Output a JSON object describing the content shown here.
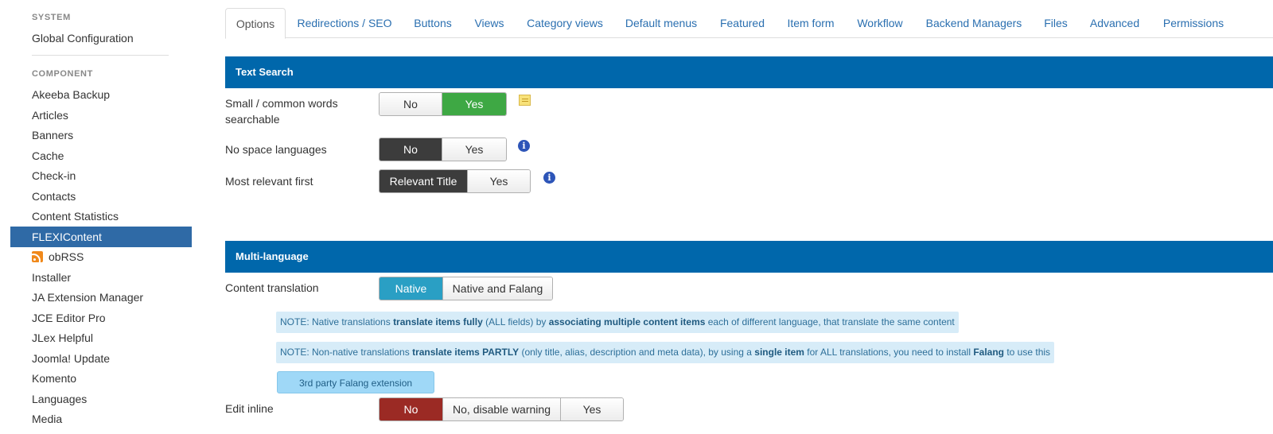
{
  "sidebar": {
    "system_heading": "SYSTEM",
    "global_config": "Global Configuration",
    "component_heading": "COMPONENT",
    "items": [
      {
        "label": "Akeeba Backup"
      },
      {
        "label": "Articles"
      },
      {
        "label": "Banners"
      },
      {
        "label": "Cache"
      },
      {
        "label": "Check-in"
      },
      {
        "label": "Contacts"
      },
      {
        "label": "Content Statistics"
      },
      {
        "label": "FLEXIContent",
        "active": true
      },
      {
        "label": "obRSS",
        "icon": "rss-icon"
      },
      {
        "label": "Installer"
      },
      {
        "label": "JA Extension Manager"
      },
      {
        "label": "JCE Editor Pro"
      },
      {
        "label": "JLex Helpful"
      },
      {
        "label": "Joomla! Update"
      },
      {
        "label": "Komento"
      },
      {
        "label": "Languages"
      },
      {
        "label": "Media"
      }
    ]
  },
  "tabs": [
    {
      "label": "Options",
      "active": true
    },
    {
      "label": "Redirections / SEO"
    },
    {
      "label": "Buttons"
    },
    {
      "label": "Views"
    },
    {
      "label": "Category views"
    },
    {
      "label": "Default menus"
    },
    {
      "label": "Featured"
    },
    {
      "label": "Item form"
    },
    {
      "label": "Workflow"
    },
    {
      "label": "Backend Managers"
    },
    {
      "label": "Files"
    },
    {
      "label": "Advanced"
    },
    {
      "label": "Permissions"
    }
  ],
  "text_search": {
    "heading": "Text Search",
    "small_words": {
      "label_line1": "Small / common words",
      "label_line2": "searchable",
      "options": [
        "No",
        "Yes"
      ],
      "selected": "Yes",
      "icon": "note-icon"
    },
    "no_space": {
      "label": "No space languages",
      "options": [
        "No",
        "Yes"
      ],
      "selected": "No",
      "icon": "info-icon"
    },
    "most_relevant": {
      "label": "Most relevant first",
      "options": [
        "Relevant Title",
        "Yes"
      ],
      "selected": "Relevant Title",
      "icon": "info-icon"
    }
  },
  "multi_language": {
    "heading": "Multi-language",
    "content_translation": {
      "label": "Content translation",
      "options": [
        "Native",
        "Native and Falang"
      ],
      "selected": "Native"
    },
    "note1": {
      "p1": "NOTE: Native translations ",
      "b1": "translate items fully",
      "p2": " (ALL fields) by ",
      "b2": "associating multiple content items",
      "p3": " each of different language, that translate the same content"
    },
    "note2": {
      "p1": "NOTE: Non-native translations ",
      "b1": "translate items PARTLY",
      "p2": " (only title, alias, description and meta data), by using a ",
      "b2": "single item",
      "p3": " for ALL translations, you need to install ",
      "b3": "Falang",
      "p4": " to use this"
    },
    "falang_button": "3rd party Falang extension",
    "edit_inline": {
      "label": "Edit inline",
      "options": [
        "No",
        "No, disable warning",
        "Yes"
      ],
      "selected": "No"
    }
  },
  "colors": {
    "section_bar": "#0067ab",
    "active_sidebar": "#2f6aa6",
    "yes_green": "#3ea844",
    "selected_dark": "#3c3c3c",
    "native_teal": "#2a9fc4",
    "no_red": "#9b2a24",
    "link_blue": "#2a6fb0"
  }
}
